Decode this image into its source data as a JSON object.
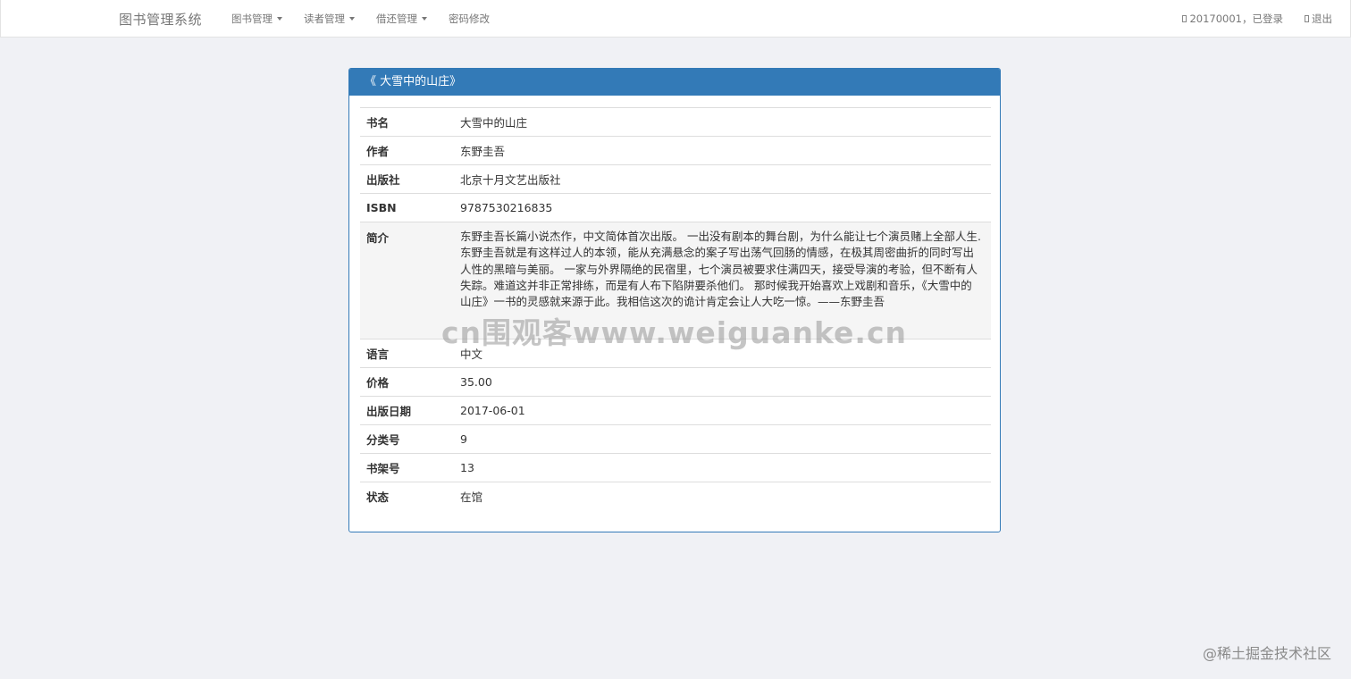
{
  "header": {
    "brand": "图书管理系统",
    "menu": [
      {
        "label": "图书管理",
        "has_dropdown": true
      },
      {
        "label": "读者管理",
        "has_dropdown": true
      },
      {
        "label": "借还管理",
        "has_dropdown": true
      },
      {
        "label": "密码修改",
        "has_dropdown": false
      }
    ],
    "user_status": "20170001，已登录",
    "logout": "退出"
  },
  "panel": {
    "title": "《 大雪中的山庄》",
    "rows": [
      {
        "label": "书名",
        "value": "大雪中的山庄"
      },
      {
        "label": "作者",
        "value": "东野圭吾"
      },
      {
        "label": "出版社",
        "value": "北京十月文艺出版社"
      },
      {
        "label": "ISBN",
        "value": "9787530216835"
      },
      {
        "label": "简介",
        "value": "东野圭吾长篇小说杰作，中文简体首次出版。 一出没有剧本的舞台剧，为什么能让七个演员赌上全部人生.东野圭吾就是有这样过人的本领，能从充满悬念的案子写出荡气回肠的情感，在极其周密曲折的同时写出人性的黑暗与美丽。 一家与外界隔绝的民宿里，七个演员被要求住满四天，接受导演的考验，但不断有人失踪。难道这并非正常排练，而是有人布下陷阱要杀他们。 那时候我开始喜欢上戏剧和音乐，《大雪中的山庄》一书的灵感就来源于此。我相信这次的诡计肯定会让人大吃一惊。——东野圭吾"
      },
      {
        "label": "语言",
        "value": "中文"
      },
      {
        "label": "价格",
        "value": "35.00"
      },
      {
        "label": "出版日期",
        "value": "2017-06-01"
      },
      {
        "label": "分类号",
        "value": "9"
      },
      {
        "label": "书架号",
        "value": "13"
      },
      {
        "label": "状态",
        "value": "在馆"
      }
    ]
  },
  "watermarks": {
    "center": "cn围观客www.weiguanke.cn",
    "corner": "@稀土掘金技术社区"
  },
  "colors": {
    "primary": "#337ab7",
    "background": "#f0f1f5",
    "description_bg": "#f5f5f5"
  }
}
